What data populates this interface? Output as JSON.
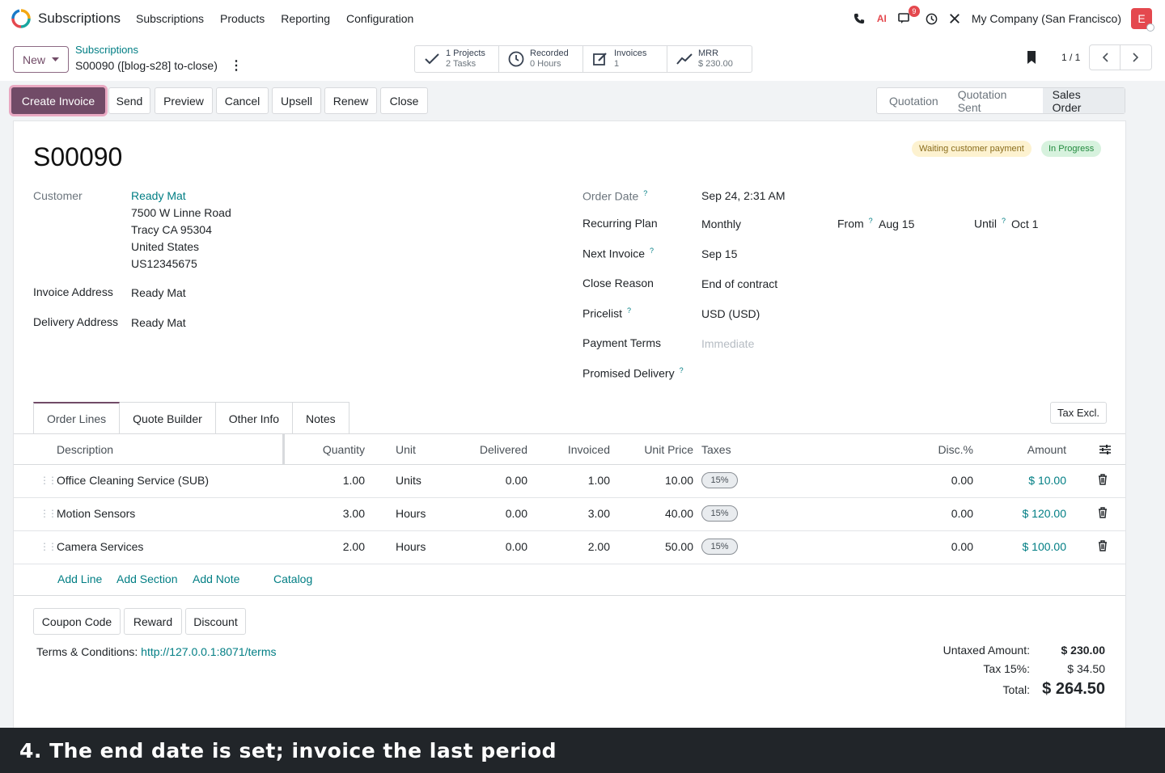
{
  "topbar": {
    "app_name": "Subscriptions",
    "menu": [
      "Subscriptions",
      "Products",
      "Reporting",
      "Configuration"
    ],
    "ai_label": "AI",
    "messages_count": "9",
    "company": "My Company (San Francisco)",
    "avatar_initial": "E"
  },
  "control": {
    "new_label": "New",
    "breadcrumb_parent": "Subscriptions",
    "breadcrumb_current": "S00090 ([blog-s28] to-close)",
    "smart_buttons": [
      {
        "line1": "1  Projects",
        "line2": "2  Tasks",
        "icon": "check-icon"
      },
      {
        "line1": "Recorded",
        "line2": "0  Hours",
        "icon": "clock-icon"
      },
      {
        "line1": "Invoices",
        "line2": "1",
        "icon": "edit-icon"
      },
      {
        "line1": "MRR",
        "line2": "$ 230.00",
        "icon": "trend-icon"
      }
    ],
    "pager": "1 / 1"
  },
  "actions": {
    "create_invoice": "Create Invoice",
    "send": "Send",
    "preview": "Preview",
    "cancel": "Cancel",
    "upsell": "Upsell",
    "renew": "Renew",
    "close": "Close"
  },
  "status": {
    "stages": [
      "Quotation",
      "Quotation Sent",
      "Sales Order"
    ],
    "active_stage": "Sales Order",
    "tag_payment": "Waiting customer payment",
    "tag_progress": "In Progress"
  },
  "record": {
    "name": "S00090",
    "customer_label": "Customer",
    "customer_name": "Ready Mat",
    "address_lines": [
      "7500 W Linne Road",
      "Tracy CA 95304",
      "United States",
      "US12345675"
    ],
    "invoice_address_label": "Invoice Address",
    "invoice_address": "Ready Mat",
    "delivery_address_label": "Delivery Address",
    "delivery_address": "Ready Mat",
    "order_date_label": "Order Date",
    "order_date": "Sep 24, 2:31 AM",
    "recurring_plan_label": "Recurring Plan",
    "recurring_plan": "Monthly",
    "from_label": "From",
    "from_value": "Aug 15",
    "until_label": "Until",
    "until_value": "Oct 1",
    "next_invoice_label": "Next Invoice",
    "next_invoice": "Sep 15",
    "close_reason_label": "Close Reason",
    "close_reason": "End of contract",
    "pricelist_label": "Pricelist",
    "pricelist": "USD (USD)",
    "payment_terms_label": "Payment Terms",
    "payment_terms_placeholder": "Immediate",
    "promised_delivery_label": "Promised Delivery",
    "help_mark": "?"
  },
  "tabs": [
    "Order Lines",
    "Quote Builder",
    "Other Info",
    "Notes"
  ],
  "tax_toggle": "Tax Excl.",
  "table": {
    "headers": {
      "description": "Description",
      "quantity": "Quantity",
      "unit": "Unit",
      "delivered": "Delivered",
      "invoiced": "Invoiced",
      "unit_price": "Unit Price",
      "taxes": "Taxes",
      "disc": "Disc.%",
      "amount": "Amount"
    },
    "rows": [
      {
        "description": "Office Cleaning Service (SUB)",
        "quantity": "1.00",
        "unit": "Units",
        "delivered": "0.00",
        "invoiced": "1.00",
        "unit_price": "10.00",
        "tax": "15%",
        "disc": "0.00",
        "amount": "$ 10.00"
      },
      {
        "description": "Motion Sensors",
        "quantity": "3.00",
        "unit": "Hours",
        "delivered": "0.00",
        "invoiced": "3.00",
        "unit_price": "40.00",
        "tax": "15%",
        "disc": "0.00",
        "amount": "$ 120.00"
      },
      {
        "description": "Camera Services",
        "quantity": "2.00",
        "unit": "Hours",
        "delivered": "0.00",
        "invoiced": "2.00",
        "unit_price": "50.00",
        "tax": "15%",
        "disc": "0.00",
        "amount": "$ 100.00"
      }
    ],
    "add_line": "Add Line",
    "add_section": "Add Section",
    "add_note": "Add Note",
    "catalog": "Catalog"
  },
  "promo": {
    "coupon": "Coupon Code",
    "reward": "Reward",
    "discount": "Discount"
  },
  "terms": {
    "label": "Terms & Conditions:",
    "link": "http://127.0.0.1:8071/terms"
  },
  "totals": {
    "untaxed_label": "Untaxed Amount:",
    "untaxed": "$ 230.00",
    "tax_label": "Tax 15%:",
    "tax": "$ 34.50",
    "total_label": "Total:",
    "total": "$ 264.50"
  },
  "caption": "4. The end date is set; invoice the last period",
  "colors": {
    "brand": "#714b67",
    "link": "#017e84",
    "caption_bg": "#212529"
  }
}
